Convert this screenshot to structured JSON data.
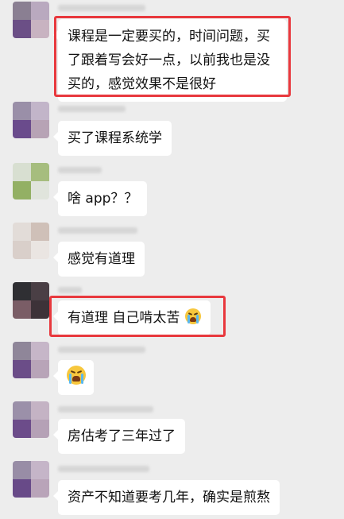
{
  "messages": [
    {
      "text": "课程是一定要买的，时间问题，买了跟着写会好一点，以前我也是没买的，感觉效果不是很好",
      "highlighted": true,
      "avatar_colors": [
        "#8a7f92",
        "#b9a9bf",
        "#6b4f86",
        "#c8b3c1"
      ]
    },
    {
      "text": "买了课程系统学",
      "highlighted": false,
      "avatar_colors": [
        "#9a8fa8",
        "#c2b5c9",
        "#6a4b8c",
        "#b7a3b5"
      ]
    },
    {
      "text": "啥 app？？",
      "highlighted": false,
      "avatar_colors": [
        "#d8dfd1",
        "#a6bd7e",
        "#93b064",
        "#e0e4dc"
      ]
    },
    {
      "text": "感觉有道理",
      "highlighted": false,
      "avatar_colors": [
        "#e2dcd8",
        "#cfc0b8",
        "#d9cfca",
        "#eae5e2"
      ]
    },
    {
      "text": "有道理 自己啃太苦",
      "highlighted": true,
      "emoji": "loudly-crying-face",
      "avatar_colors": [
        "#2f2f33",
        "#4a3f45",
        "#7a5d66",
        "#3d3238"
      ]
    },
    {
      "text": "",
      "highlighted": false,
      "emoji": "loudly-crying-face",
      "avatar_colors": [
        "#8f8699",
        "#c6b6c8",
        "#6b4d88",
        "#b8a4b8"
      ]
    },
    {
      "text": "房估考了三年过了",
      "highlighted": false,
      "avatar_colors": [
        "#9b90a9",
        "#c4b3c4",
        "#6c4c8a",
        "#b5a1b6"
      ]
    },
    {
      "text": "资产不知道要考几年，确实是煎熬",
      "highlighted": false,
      "avatar_colors": [
        "#988da6",
        "#c5b5c8",
        "#684a88",
        "#b9a4b9"
      ]
    }
  ]
}
